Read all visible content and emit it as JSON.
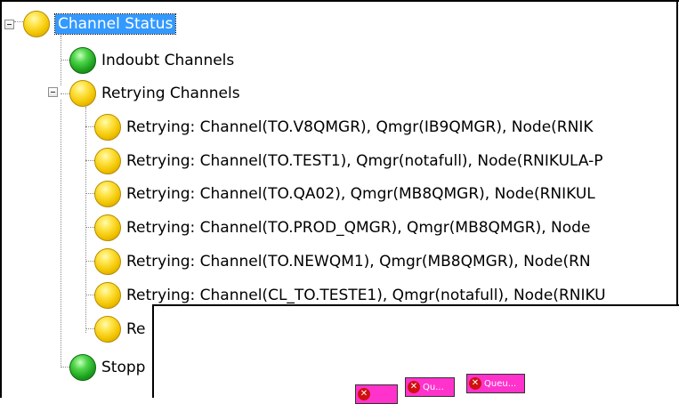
{
  "tree": {
    "root": {
      "label": "Channel Status",
      "status": "yellow",
      "selected": true
    },
    "indoubt": {
      "label": "Indoubt Channels",
      "status": "green"
    },
    "retrying": {
      "label": "Retrying Channels",
      "status": "yellow",
      "items": [
        "Retrying: Channel(TO.V8QMGR), Qmgr(IB9QMGR), Node(RNIK",
        "Retrying: Channel(TO.TEST1), Qmgr(notafull), Node(RNIKULA-P",
        "Retrying: Channel(TO.QA02), Qmgr(MB8QMGR), Node(RNIKUL",
        "Retrying: Channel(TO.PROD_QMGR), Qmgr(MB8QMGR), Node",
        "Retrying: Channel(TO.NEWQM1), Qmgr(MB8QMGR), Node(RN",
        "Retrying: Channel(CL_TO.TESTE1), Qmgr(notafull), Node(RNIKU",
        "Re"
      ]
    },
    "stopped": {
      "label": "Stopp",
      "status": "green"
    }
  },
  "overlay": {
    "buttons": [
      {
        "label": ""
      },
      {
        "label": "Qu..."
      },
      {
        "label": "Queu..."
      }
    ]
  },
  "colors": {
    "selection": "#3399ff",
    "retrying_orb": "#f2c500",
    "ok_orb": "#1ea01e",
    "mini_button": "#ff33cc"
  }
}
